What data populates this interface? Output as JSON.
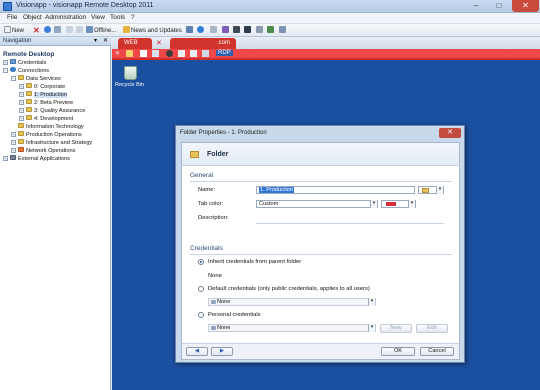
{
  "window": {
    "title": "Visionapp - visionapp Remote Desktop 2011",
    "minimize_glyph": "–",
    "maximize_glyph": "□",
    "close_glyph": "✕"
  },
  "menu": [
    "File",
    "Object",
    "Administration",
    "View",
    "Tools",
    "?"
  ],
  "toolbar": {
    "new_label": "New",
    "offline_label": "Offline...",
    "news_label": "News and Updates"
  },
  "navigation": {
    "header": "Navigation",
    "pin_glyph": "▾ ✕",
    "title": "Remote Desktop",
    "tree": [
      {
        "label": "Credentials",
        "level": 0,
        "icon": "credentials-icon",
        "expander": "+"
      },
      {
        "label": "Connections",
        "level": 0,
        "icon": "globe-icon",
        "expander": "−"
      },
      {
        "label": "Data Services",
        "level": 1,
        "icon": "folder-icon",
        "expander": "−"
      },
      {
        "label": "0: Corporate",
        "level": 2,
        "icon": "folder-icon",
        "expander": "+"
      },
      {
        "label": "1: Production",
        "level": 2,
        "icon": "folder-icon",
        "expander": "+"
      },
      {
        "label": "2: Beta Preview",
        "level": 2,
        "icon": "folder-icon",
        "expander": "+"
      },
      {
        "label": "3: Quality Assurance",
        "level": 2,
        "icon": "folder-icon",
        "expander": "+"
      },
      {
        "label": "4: Development",
        "level": 2,
        "icon": "folder-icon",
        "expander": "+"
      },
      {
        "label": "Information Technology",
        "level": 1,
        "icon": "folder-icon",
        "expander": ""
      },
      {
        "label": "Production Operations",
        "level": 1,
        "icon": "folder-icon",
        "expander": "+"
      },
      {
        "label": "Infrastructure and Strategy",
        "level": 1,
        "icon": "folder-icon",
        "expander": "+"
      },
      {
        "label": "Network Operations",
        "level": 1,
        "icon": "folder-red-icon",
        "expander": "+"
      },
      {
        "label": "External Applications",
        "level": 0,
        "icon": "external-icon",
        "expander": "+"
      }
    ]
  },
  "tabs": {
    "web": "WEB",
    "com": ".com",
    "rdp": "RDP"
  },
  "desktop": {
    "recycle_bin": "Recycle Bin"
  },
  "dialog": {
    "title": "Folder Properties - 1. Production",
    "close_glyph": "✕",
    "header": "Folder",
    "general_heading": "General",
    "name_label": "Name:",
    "name_value": "1. Production",
    "tab_color_label": "Tab color:",
    "tab_color_value": "Custom",
    "tab_color_swatch": "#d7303a",
    "description_label": "Description:",
    "credentials_heading": "Credentials",
    "inherit_label": "Inherit credentials from parent folder",
    "inherit_value": "None",
    "default_label": "Default credentials (only public credentials, applies to all users)",
    "default_value": "None",
    "personal_label": "Personal credentials",
    "personal_value": "None",
    "new_button": "New",
    "edit_button": "Edit",
    "ok_button": "OK",
    "cancel_button": "Cancel",
    "back_glyph": "◀",
    "forward_glyph": "▶",
    "dropdown_glyph": "▾"
  },
  "colors": {
    "tab_red": "#d0342c",
    "desktop_blue": "#1b4f9f",
    "accent": "#2c5db0"
  }
}
